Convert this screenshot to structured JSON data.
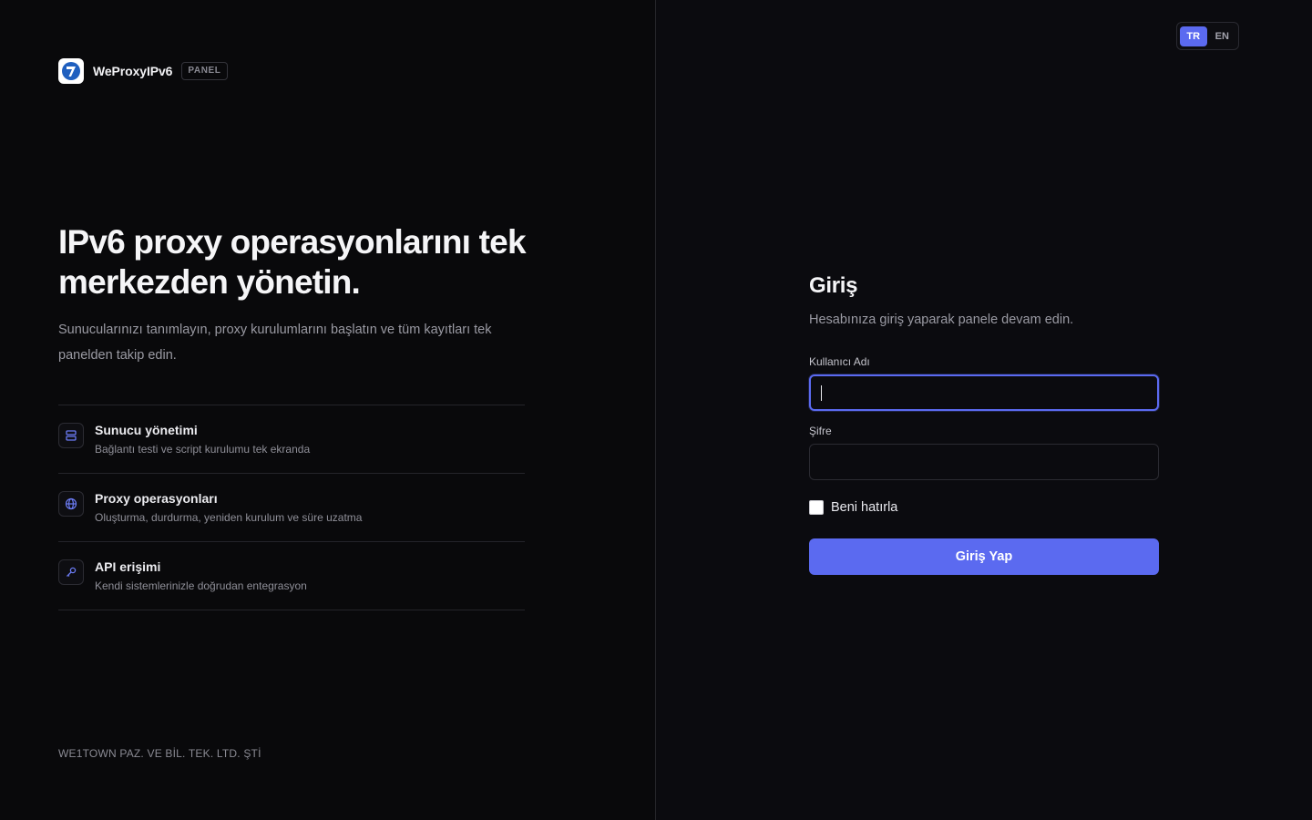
{
  "brand": {
    "name": "WeProxyIPv6",
    "badge": "PANEL"
  },
  "hero": {
    "title": "IPv6 proxy operasyonlarını tek merkezden yönetin.",
    "subtitle": "Sunucularınızı tanımlayın, proxy kurulumlarını başlatın ve tüm kayıtları tek panelden takip edin."
  },
  "features": [
    {
      "icon": "server-icon",
      "title": "Sunucu yönetimi",
      "description": "Bağlantı testi ve script kurulumu tek ekranda"
    },
    {
      "icon": "globe-icon",
      "title": "Proxy operasyonları",
      "description": "Oluşturma, durdurma, yeniden kurulum ve süre uzatma"
    },
    {
      "icon": "key-icon",
      "title": "API erişimi",
      "description": "Kendi sistemlerinizle doğrudan entegrasyon"
    }
  ],
  "footer": {
    "company": "WE1TOWN PAZ. VE BİL. TEK. LTD. ŞTİ"
  },
  "language": {
    "options": [
      "TR",
      "EN"
    ],
    "selected": "TR"
  },
  "login": {
    "title": "Giriş",
    "subtitle": "Hesabınıza giriş yaparak panele devam edin.",
    "username_label": "Kullanıcı Adı",
    "username_value": "",
    "password_label": "Şifre",
    "password_value": "",
    "remember_label": "Beni hatırla",
    "remember_checked": false,
    "submit_label": "Giriş Yap"
  },
  "colors": {
    "accent": "#5b6af0",
    "background_left": "#09090b",
    "background_right": "#0b0b0f"
  }
}
